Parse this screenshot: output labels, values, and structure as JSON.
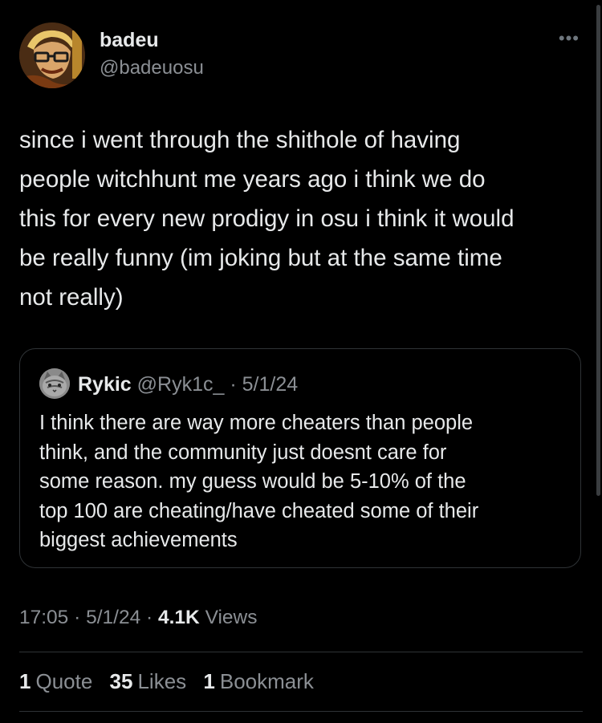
{
  "tweet": {
    "author": {
      "display_name": "badeu",
      "handle": "@badeuosu"
    },
    "more_icon": "more-horizontal-icon",
    "text": "since i went through the shithole of having\npeople witchhunt me years ago i think we do\nthis for every new prodigy in osu i think it would\nbe really funny (im joking but at the same time\nnot really)",
    "time": "17:05",
    "date": "5/1/24",
    "views_count": "4.1K",
    "views_label": "Views"
  },
  "quote": {
    "display_name": "Rykic",
    "handle": "@Ryk1c_",
    "separator": "·",
    "date": "5/1/24",
    "text": "I think there are way more cheaters than people\nthink, and the community just doesnt care for\nsome reason. my guess would be 5-10% of the\ntop 100 are cheating/have cheated some of their\nbiggest achievements"
  },
  "stats": [
    {
      "count": "1",
      "label": "Quote"
    },
    {
      "count": "35",
      "label": "Likes"
    },
    {
      "count": "1",
      "label": "Bookmark"
    }
  ],
  "colors": {
    "background": "#000000",
    "text": "#e7e9ea",
    "secondary": "#8b8f94",
    "border": "#2f3336"
  }
}
